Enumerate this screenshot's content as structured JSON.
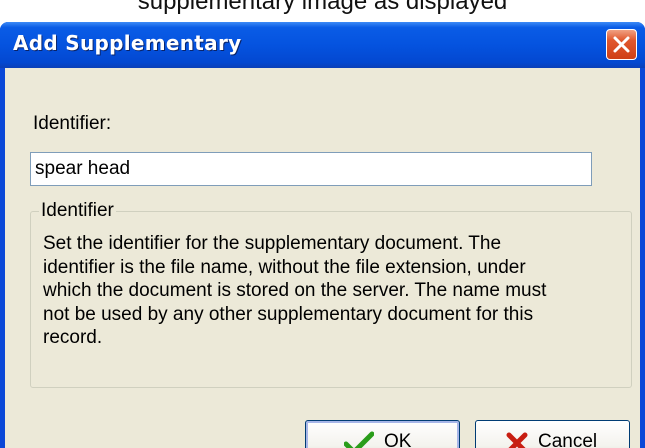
{
  "caption": "supplementary image as displayed",
  "window": {
    "title": "Add Supplementary",
    "close_icon": "close-icon",
    "colors": {
      "title_bar": "#0553df",
      "client_bg": "#ece9d8",
      "close_button": "#e1582e"
    }
  },
  "form": {
    "identifier_label": "Identifier:",
    "identifier_value": "spear head"
  },
  "help_group": {
    "legend": "Identifier",
    "lines": [
      "Set the identifier for the supplementary document. The",
      "identifier is the file name, without the file extension, under",
      "which the document is stored on the server. The name must",
      "not be used by any other supplementary document for this",
      "record."
    ]
  },
  "buttons": {
    "ok": {
      "label": "OK",
      "icon": "check-icon",
      "color": "#2a9d1a"
    },
    "cancel": {
      "label": "Cancel",
      "icon": "cross-icon",
      "color": "#c81e12"
    }
  }
}
